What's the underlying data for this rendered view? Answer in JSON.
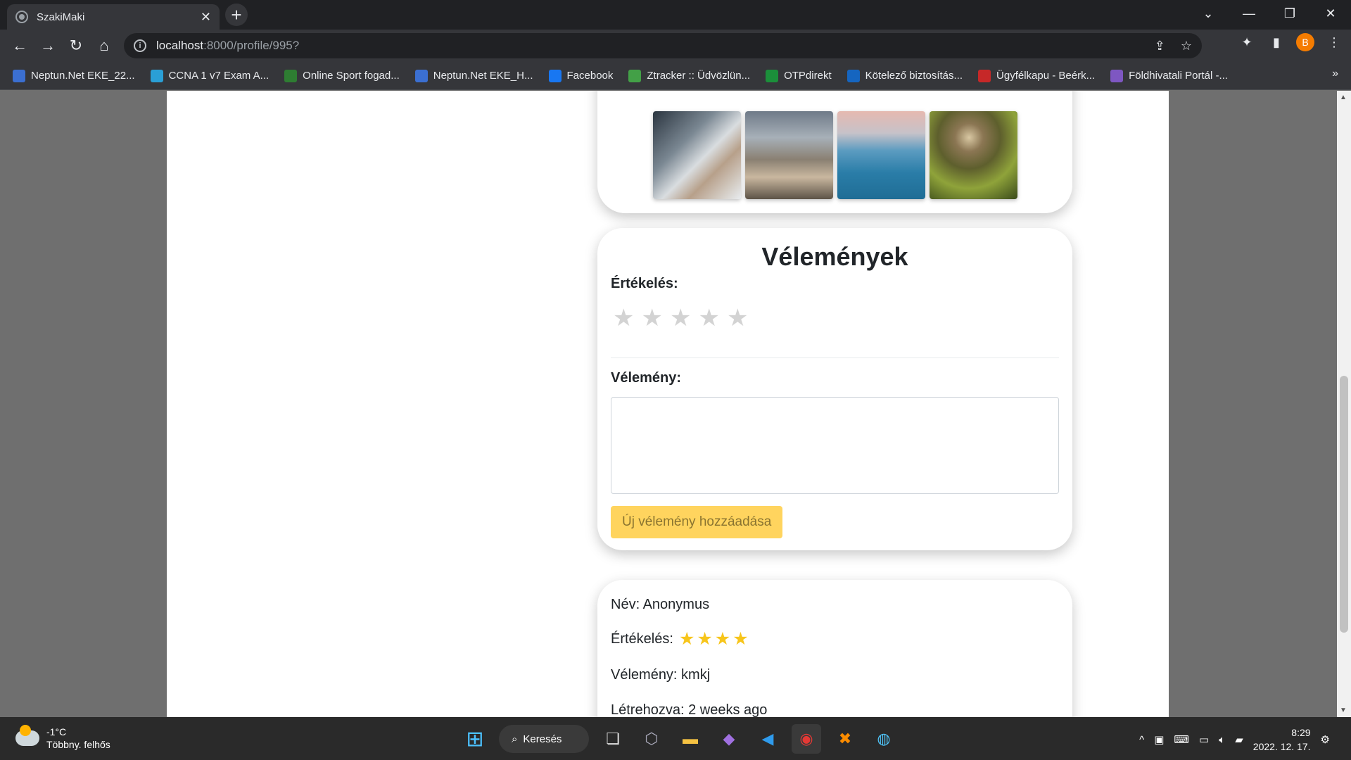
{
  "browser": {
    "tab_title": "SzakiMaki",
    "url_host": "localhost",
    "url_path": ":8000/profile/995?",
    "profile_initial": "B",
    "bookmarks": [
      {
        "label": "Neptun.Net EKE_22...",
        "color": "#3b6fd1"
      },
      {
        "label": "CCNA 1 v7 Exam A...",
        "color": "#2a9fd6"
      },
      {
        "label": "Online Sport fogad...",
        "color": "#2e7d32"
      },
      {
        "label": "Neptun.Net EKE_H...",
        "color": "#3b6fd1"
      },
      {
        "label": "Facebook",
        "color": "#1877f2"
      },
      {
        "label": "Ztracker :: Üdvözlün...",
        "color": "#43a047"
      },
      {
        "label": "OTPdirekt",
        "color": "#1b8f3a"
      },
      {
        "label": "Kötelező biztosítás...",
        "color": "#1565c0"
      },
      {
        "label": "Ügyfélkapu - Beérk...",
        "color": "#c62828"
      },
      {
        "label": "Földhivatali Portál -...",
        "color": "#7e57c2"
      }
    ]
  },
  "reviews": {
    "title": "Vélemények",
    "rating_label": "Értékelés:",
    "rating_stars": 5,
    "comment_label": "Vélemény:",
    "comment_value": "",
    "submit_label": "Új vélemény hozzáadása"
  },
  "comment": {
    "name_line": "Név: Anonymus",
    "rating_prefix": "Értékelés:",
    "rating_value": 4,
    "opinion_line": "Vélemény: kmkj",
    "created_line": "Létrehozva: 2 weeks ago"
  },
  "taskbar": {
    "temperature": "-1°C",
    "weather_desc": "Többny. felhős",
    "search_label": "Keresés",
    "time": "8:29",
    "date": "2022. 12. 17."
  },
  "colors": {
    "accent_yellow": "#ffd45e",
    "star_gold": "#f7c51b",
    "star_empty": "#d3d3d3"
  }
}
